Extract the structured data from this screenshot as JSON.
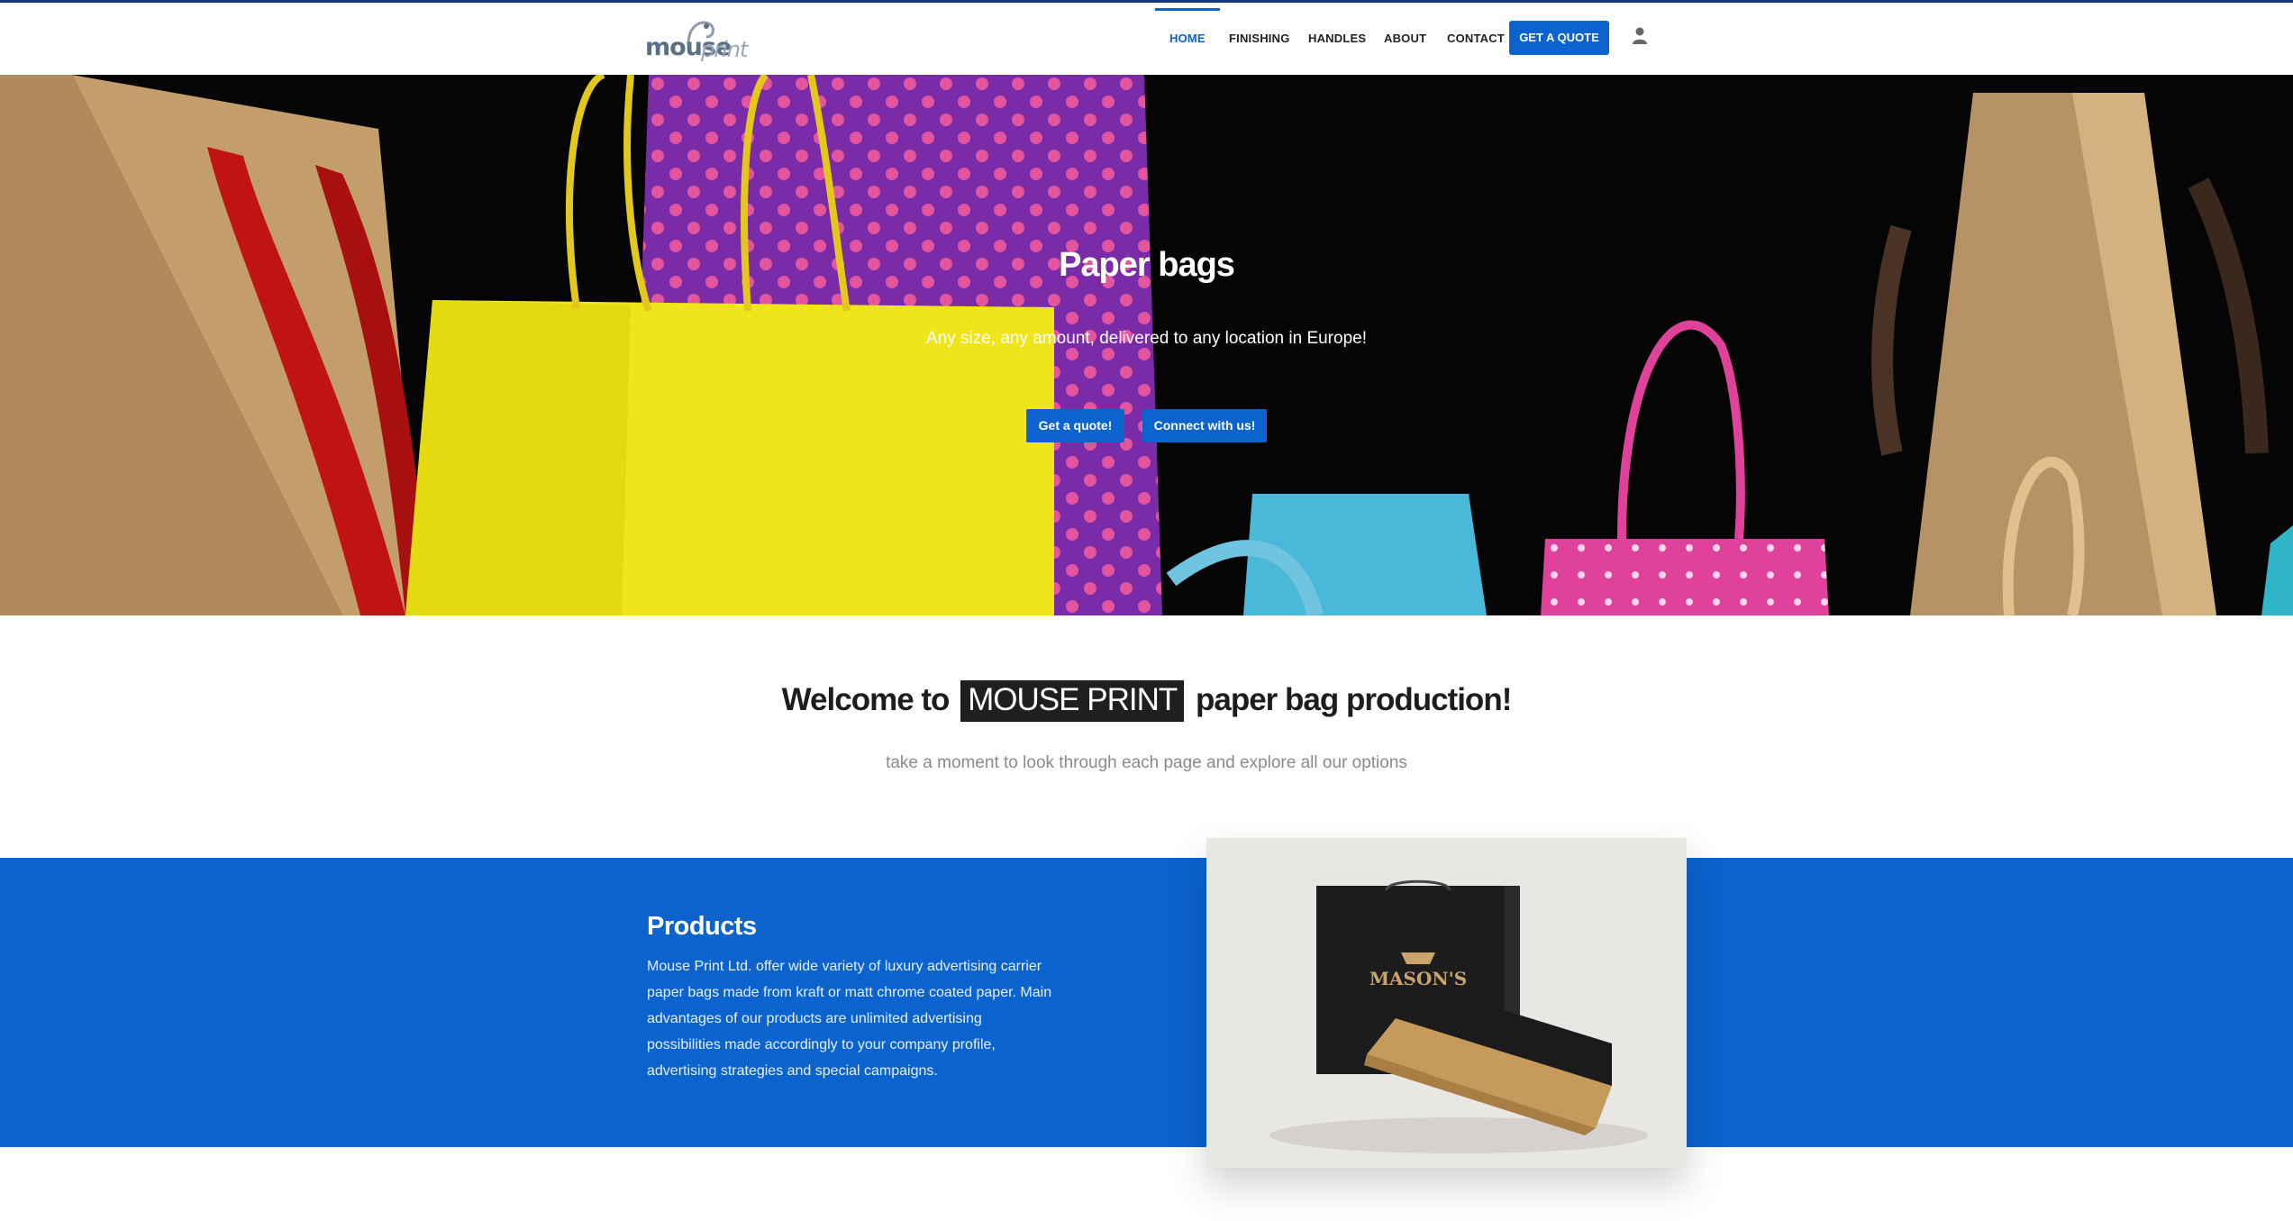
{
  "header": {
    "logo_text_1": "mouse",
    "logo_text_2": "print",
    "nav": [
      {
        "label": "HOME",
        "active": true
      },
      {
        "label": "FINISHING",
        "active": false
      },
      {
        "label": "HANDLES",
        "active": false
      },
      {
        "label": "ABOUT",
        "active": false
      },
      {
        "label": "CONTACT",
        "active": false
      }
    ],
    "quote_button": "GET A QUOTE",
    "account_icon": "user-icon"
  },
  "hero": {
    "title": "Paper bags",
    "subtitle": "Any size, any amount, delivered to any location in Europe!",
    "button_quote": "Get a quote!",
    "button_connect": "Connect with us!"
  },
  "welcome": {
    "prefix": "Welcome to",
    "highlight": "MOUSE PRINT",
    "suffix": "paper bag production!",
    "subtitle": "take a moment to look through each page and explore all our options"
  },
  "products": {
    "title": "Products",
    "text": "Mouse Print Ltd. offer wide variety of luxury advertising carrier paper bags made from kraft or matt chrome coated paper. Main advantages of our products are unlimited advertising possibilities made accordingly to your company profile, advertising strategies and special campaigns.",
    "image_brand": "MASON'S"
  },
  "colors": {
    "accent": "#0b63ce",
    "dark": "#1f1f1f"
  }
}
